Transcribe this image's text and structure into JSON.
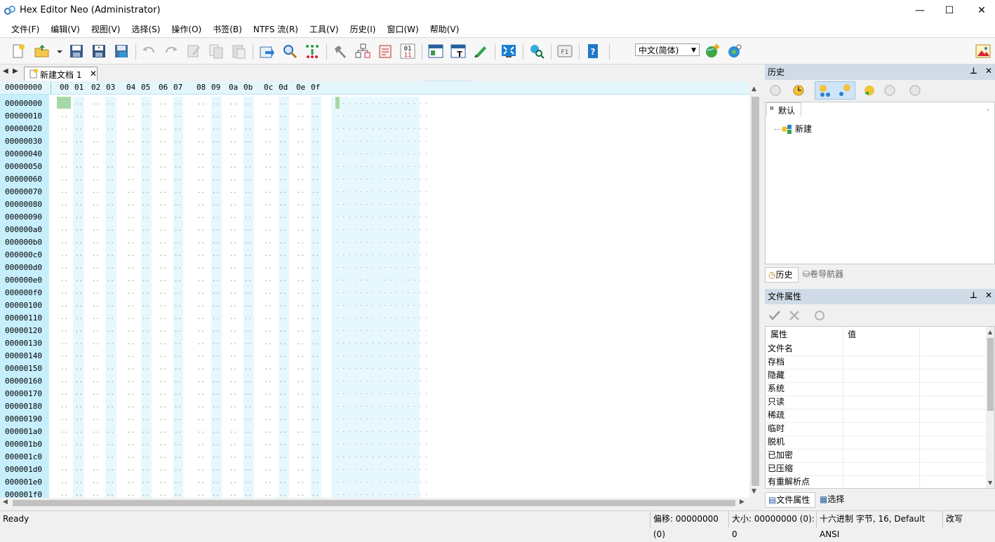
{
  "window": {
    "title": "Hex Editor Neo (Administrator)",
    "minimize": "—",
    "maximize": "☐",
    "close": "✕"
  },
  "menu": [
    "文件(F)",
    "编辑(V)",
    "视图(V)",
    "选择(S)",
    "操作(O)",
    "书签(B)",
    "NTFS 流(R)",
    "工具(V)",
    "历史(I)",
    "窗口(W)",
    "帮助(V)"
  ],
  "toolbar": {
    "language": "中文(简体)"
  },
  "document": {
    "tab_label": "新建文档 1",
    "tab_close": "✕",
    "nav_left": "◀",
    "nav_right": "▶",
    "header_offset": "00000000",
    "header_cols": [
      "00",
      "01",
      "02",
      "03",
      "04",
      "05",
      "06",
      "07",
      "08",
      "09",
      "0a",
      "0b",
      "0c",
      "0d",
      "0e",
      "0f"
    ],
    "offsets": [
      "00000000",
      "00000010",
      "00000020",
      "00000030",
      "00000040",
      "00000050",
      "00000060",
      "00000070",
      "00000080",
      "00000090",
      "000000a0",
      "000000b0",
      "000000c0",
      "000000d0",
      "000000e0",
      "000000f0",
      "00000100",
      "00000110",
      "00000120",
      "00000130",
      "00000140",
      "00000150",
      "00000160",
      "00000170",
      "00000180",
      "00000190",
      "000001a0",
      "000001b0",
      "000001c0",
      "000001d0",
      "000001e0",
      "000001f0"
    ],
    "empty_byte": "..",
    "empty_char": "................"
  },
  "history_panel": {
    "title": "历史",
    "pin": "⊥",
    "close": "✕",
    "branch": "默认",
    "entry": "新建",
    "tab_history": "历史",
    "tab_volume": "卷导航器"
  },
  "properties_panel": {
    "title": "文件属性",
    "pin": "⊥",
    "close": "✕",
    "col_property": "属性",
    "col_value": "值",
    "rows": [
      "文件名",
      "存档",
      "隐藏",
      "系统",
      "只读",
      "稀疏",
      "临时",
      "脱机",
      "已加密",
      "已压缩",
      "有重解析点"
    ],
    "tab_props": "文件属性",
    "tab_select": "选择"
  },
  "status": {
    "ready": "Ready",
    "offset": "偏移: 00000000 (0)",
    "size": "大小: 00000000 (0): 0",
    "encoding": "十六进制 字节, 16, Default ANSI",
    "mode": "改写"
  },
  "colors": {
    "offset_bg": "#c6eefb",
    "stripe_bg": "#e6f8fd",
    "caret": "#a8d8a8",
    "panel_header": "#cfdbe6"
  }
}
